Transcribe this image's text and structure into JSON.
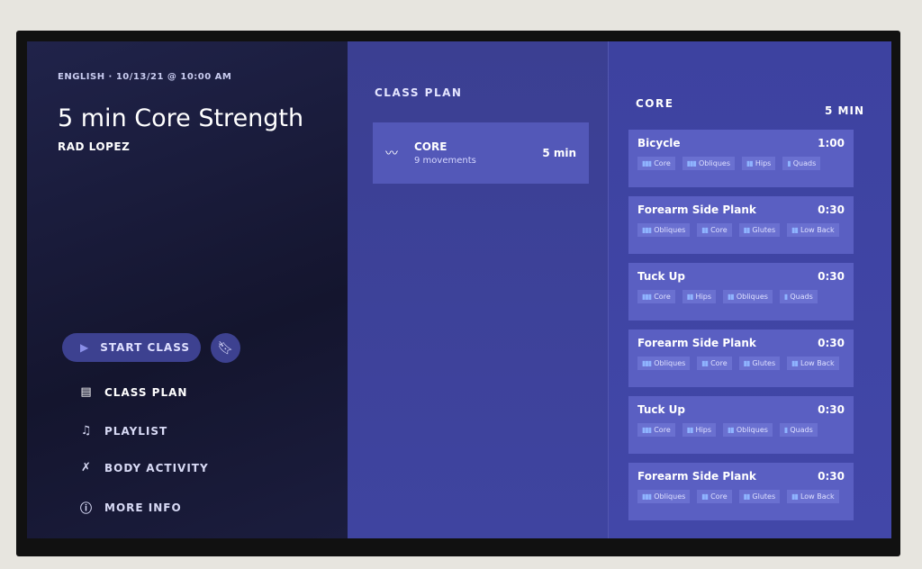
{
  "header": {
    "language": "ENGLISH",
    "datetime": "10/13/21 @ 10:00 AM",
    "title": "5 min Core Strength",
    "instructor": "RAD LOPEZ"
  },
  "actions": {
    "start_label": "START CLASS",
    "bookmark_icon": "bookmark-icon"
  },
  "nav": [
    {
      "label": "CLASS PLAN",
      "icon": "list-icon",
      "active": true
    },
    {
      "label": "PLAYLIST",
      "icon": "music-note-icon"
    },
    {
      "label": "BODY ACTIVITY",
      "icon": "body-icon"
    },
    {
      "label": "MORE INFO",
      "icon": "info-icon"
    }
  ],
  "class_plan": {
    "heading": "CLASS PLAN",
    "section": {
      "name": "CORE",
      "movements": "9 movements",
      "duration": "5 min"
    }
  },
  "core": {
    "heading": "CORE",
    "duration": "5 MIN",
    "movements": [
      {
        "name": "Bicycle",
        "time": "1:00",
        "tags": [
          {
            "label": "Core",
            "level": 3
          },
          {
            "label": "Obliques",
            "level": 3
          },
          {
            "label": "Hips",
            "level": 2
          },
          {
            "label": "Quads",
            "level": 1
          }
        ]
      },
      {
        "name": "Forearm Side Plank",
        "time": "0:30",
        "tags": [
          {
            "label": "Obliques",
            "level": 3
          },
          {
            "label": "Core",
            "level": 2
          },
          {
            "label": "Glutes",
            "level": 2
          },
          {
            "label": "Low Back",
            "level": 2
          }
        ]
      },
      {
        "name": "Tuck Up",
        "time": "0:30",
        "tags": [
          {
            "label": "Core",
            "level": 3
          },
          {
            "label": "Hips",
            "level": 2
          },
          {
            "label": "Obliques",
            "level": 2
          },
          {
            "label": "Quads",
            "level": 1
          }
        ]
      },
      {
        "name": "Forearm Side Plank",
        "time": "0:30",
        "tags": [
          {
            "label": "Obliques",
            "level": 3
          },
          {
            "label": "Core",
            "level": 2
          },
          {
            "label": "Glutes",
            "level": 2
          },
          {
            "label": "Low Back",
            "level": 2
          }
        ]
      },
      {
        "name": "Tuck Up",
        "time": "0:30",
        "tags": [
          {
            "label": "Core",
            "level": 3
          },
          {
            "label": "Hips",
            "level": 2
          },
          {
            "label": "Obliques",
            "level": 2
          },
          {
            "label": "Quads",
            "level": 1
          }
        ]
      },
      {
        "name": "Forearm Side Plank",
        "time": "0:30",
        "tags": [
          {
            "label": "Obliques",
            "level": 3
          },
          {
            "label": "Core",
            "level": 2
          },
          {
            "label": "Glutes",
            "level": 2
          },
          {
            "label": "Low Back",
            "level": 2
          }
        ]
      }
    ]
  },
  "colors": {
    "left_panel": "#17183a",
    "mid_panel": "#3d4196",
    "card": "#5a5fc2",
    "accent": "#3d4190"
  }
}
